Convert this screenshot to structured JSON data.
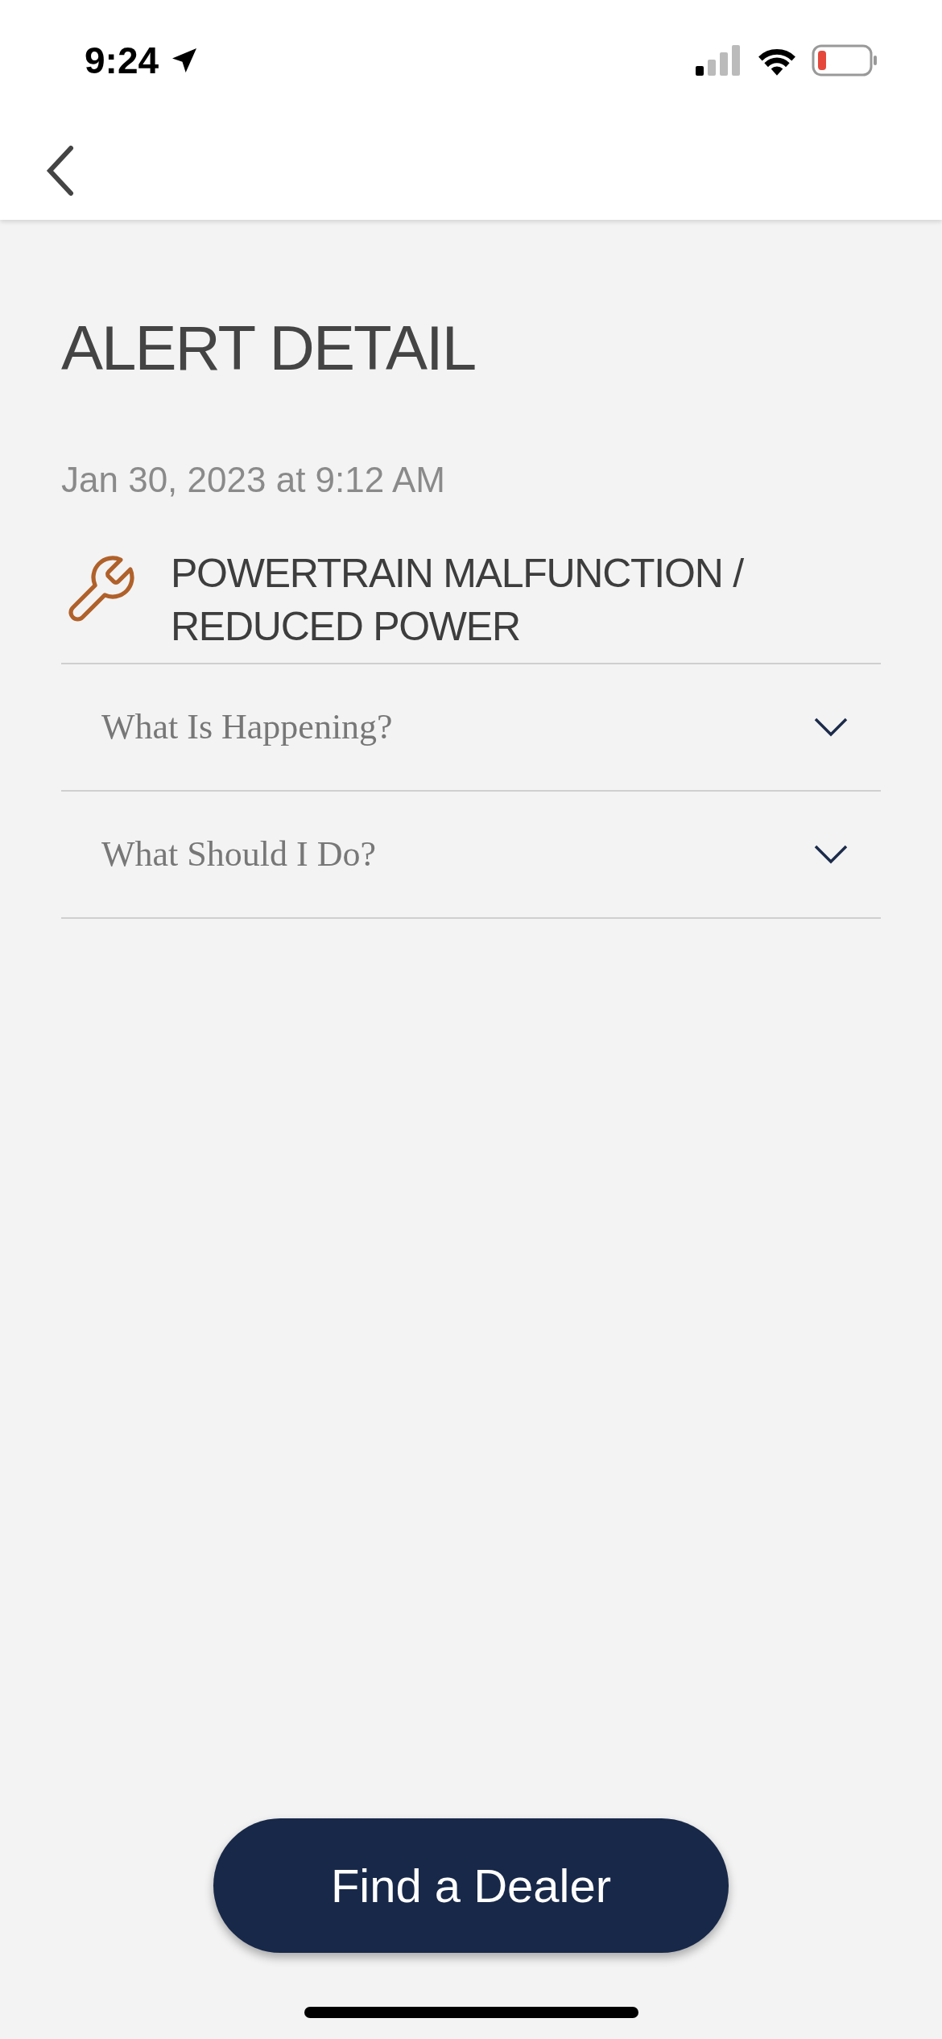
{
  "status_bar": {
    "time": "9:24"
  },
  "page": {
    "title": "ALERT DETAIL",
    "date": "Jan 30, 2023 at 9:12 AM"
  },
  "alert": {
    "title": "POWERTRAIN MALFUNCTION / REDUCED POWER"
  },
  "sections": [
    {
      "label": "What Is Happening?",
      "expanded": false
    },
    {
      "label": "What Should I Do?",
      "expanded": false
    }
  ],
  "action": {
    "label": "Find a Dealer"
  }
}
